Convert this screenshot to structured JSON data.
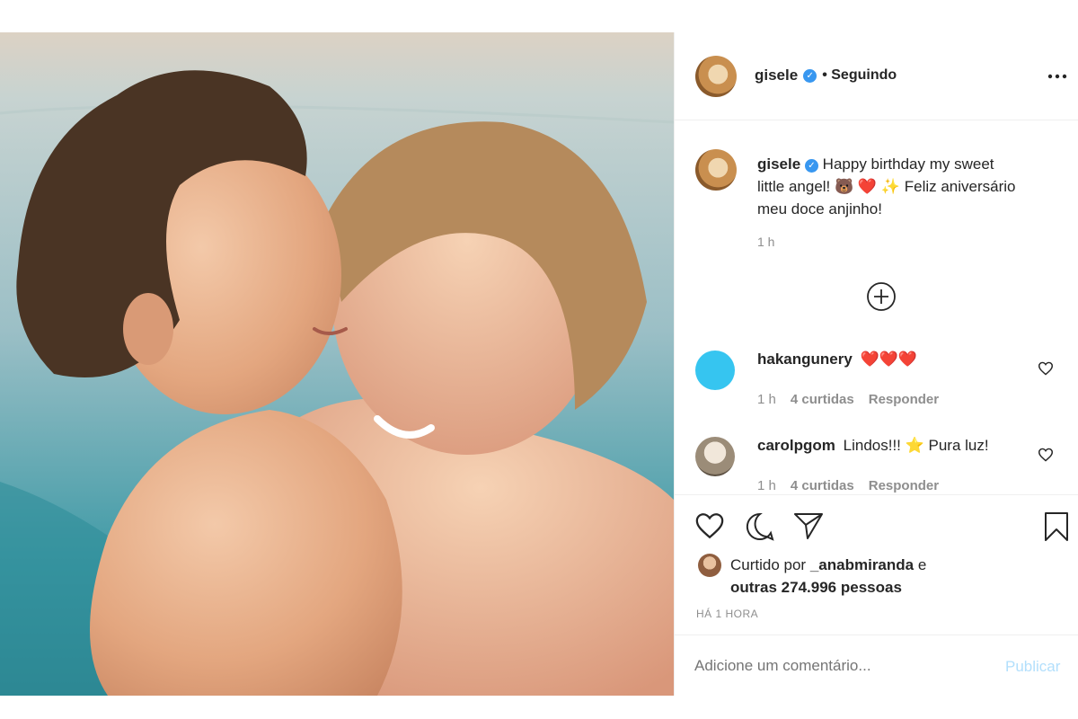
{
  "post": {
    "username": "gisele",
    "follow_status": "• Seguindo",
    "more_icon": "more-horizontal-icon"
  },
  "caption": {
    "username": "gisele",
    "text_line1": "Happy birthday my sweet",
    "text_line2_a": "little angel!",
    "text_line2_b": "Feliz aniversário",
    "text_line3": "meu doce anjinho!",
    "emojis": [
      "🐻",
      "❤️",
      "✨"
    ],
    "time": "1 h"
  },
  "comments": [
    {
      "username": "hakangunery",
      "text": "❤️❤️❤️",
      "time": "1 h",
      "likes": "4 curtidas",
      "reply": "Responder",
      "avatar_color": "#36c5f0"
    },
    {
      "username": "carolpgom",
      "text": "Lindos!!! ⭐ Pura luz!",
      "time": "1 h",
      "likes": "4 curtidas",
      "reply": "Responder"
    }
  ],
  "likes": {
    "line1": "Curtido por",
    "liker": "_anabmiranda",
    "line1_tail": "e",
    "line2": "outras 274.996 pessoas"
  },
  "timestamp": "HÁ 1 HORA",
  "composer": {
    "placeholder": "Adicione um comentário...",
    "publish_label": "Publicar"
  },
  "colors": {
    "accent": "#3897f0",
    "heart": "#ed4956",
    "publish_disabled": "#b2dffc"
  }
}
